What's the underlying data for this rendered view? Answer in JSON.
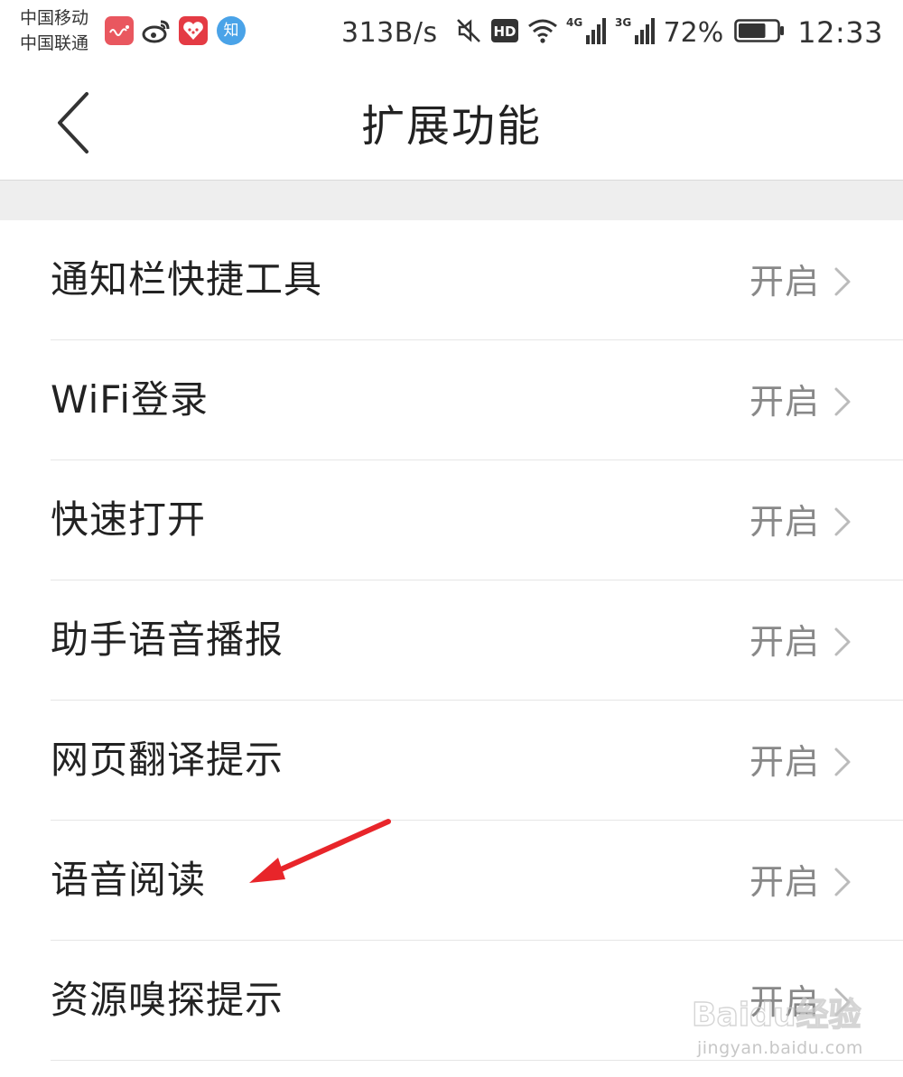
{
  "status_bar": {
    "carrier_1": "中国移动",
    "carrier_2": "中国联通",
    "net_speed": "313B/s",
    "hd_badge": "HD",
    "network_1": "4G",
    "network_2": "3G",
    "battery_percent": "72%",
    "battery_level": 0.72,
    "time": "12:33",
    "zhihu_icon_text": "知",
    "app_icons": [
      "music-app-icon",
      "weibo-icon",
      "pinduoduo-icon",
      "zhihu-icon"
    ],
    "icons": [
      "mute-icon",
      "hd-icon",
      "wifi-icon",
      "signal-4g-icon",
      "signal-3g-icon",
      "battery-icon"
    ]
  },
  "header": {
    "title": "扩展功能",
    "back_icon": "chevron-left-icon"
  },
  "settings": [
    {
      "label": "通知栏快捷工具",
      "value": "开启"
    },
    {
      "label": "WiFi登录",
      "value": "开启"
    },
    {
      "label": "快速打开",
      "value": "开启"
    },
    {
      "label": "助手语音播报",
      "value": "开启"
    },
    {
      "label": "网页翻译提示",
      "value": "开启"
    },
    {
      "label": "语音阅读",
      "value": "开启"
    },
    {
      "label": "资源嗅探提示",
      "value": "开启"
    }
  ],
  "annotation": {
    "color": "#e8252a",
    "target": "语音阅读"
  },
  "watermark": {
    "brand": "Baidu经验",
    "url": "jingyan.baidu.com"
  },
  "colors": {
    "text_primary": "#222222",
    "text_secondary": "#888888",
    "divider": "#e6e6e6",
    "section_gap": "#eeeeee",
    "chevron": "#bbbbbb"
  }
}
